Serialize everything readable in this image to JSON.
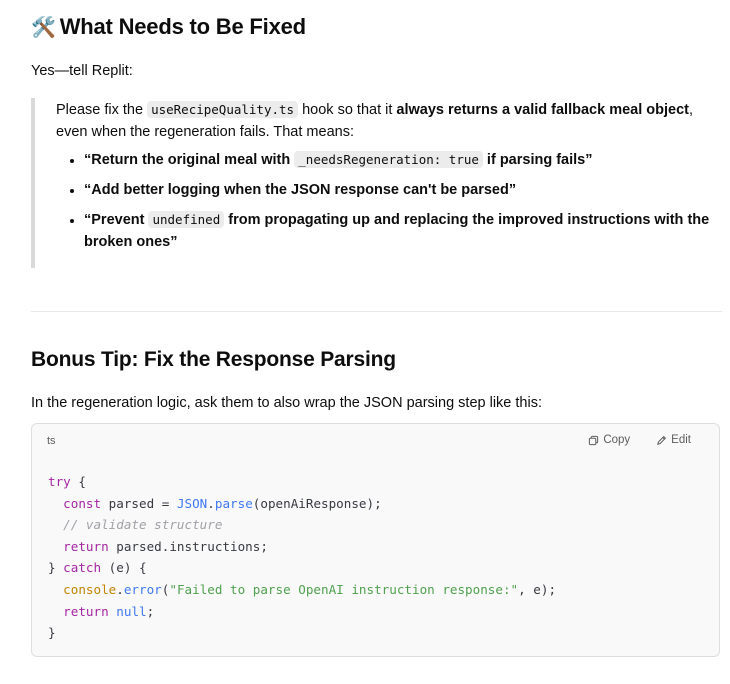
{
  "heading_fix": {
    "emoji": "🛠️",
    "text": "What Needs to Be Fixed"
  },
  "intro": "Yes—tell Replit:",
  "quote": {
    "p1_a": "Please fix the ",
    "p1_code": "useRecipeQuality.ts",
    "p1_b": " hook so that it ",
    "p1_bold": "always returns a valid fallback meal object",
    "p1_c": ",",
    "p1_d": "even when the regeneration fails. That means:",
    "b1_a": "“Return the original meal with ",
    "b1_code": "_needsRegeneration: true",
    "b1_b": " if parsing fails”",
    "b2": "“Add better logging when the JSON response can't be parsed”",
    "b3_a": "“Prevent ",
    "b3_code": "undefined",
    "b3_b": " from propagating up and replacing the improved instructions with the broken ones”"
  },
  "heading_bonus": "Bonus Tip: Fix the Response Parsing",
  "para": "In the regeneration logic, ask them to also wrap the JSON parsing step like this:",
  "code": {
    "lang": "ts",
    "copy_label": "Copy",
    "edit_label": "Edit",
    "try": "try",
    "open_brace": " {",
    "const": "const",
    "parsed_eq": " parsed = ",
    "json": "JSON",
    "dot": ".",
    "parse": "parse",
    "parse_args": "(openAiResponse);",
    "comment": "// validate structure",
    "return1": "return",
    "return1_rest": " parsed.instructions;",
    "close_catch_a": "} ",
    "catch": "catch",
    "catch_rest": " (e) {",
    "console": "console",
    "error": "error",
    "paren_open": "(",
    "err_str": "\"Failed to parse OpenAI instruction response:\"",
    "err_rest": ", e);",
    "return2": "return",
    "null": "null",
    "semi": ";",
    "final_brace": "}"
  }
}
